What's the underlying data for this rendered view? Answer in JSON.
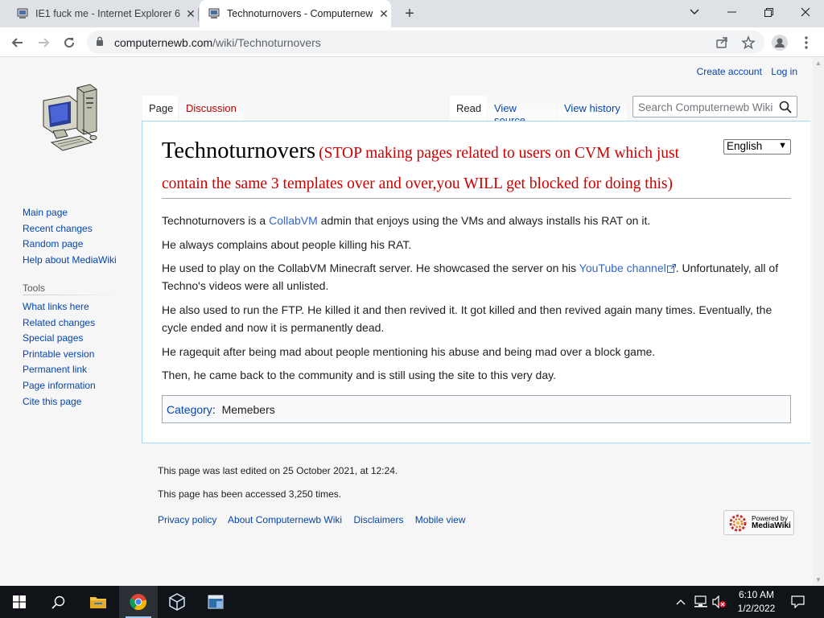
{
  "browser": {
    "tabs": [
      {
        "title": "IE1 fuck me - Internet Explorer 6",
        "active": false
      },
      {
        "title": "Technoturnovers - Computernewb",
        "active": true
      }
    ],
    "new_tab": "+",
    "window_controls": {
      "list": "⌄",
      "minimize": "—",
      "restore": "⧉",
      "close": "✕"
    },
    "url_host": "computernewb.com",
    "url_path": "/wiki/Technoturnovers"
  },
  "personal": {
    "create_account": "Create account",
    "log_in": "Log in"
  },
  "page_tabs": {
    "page": "Page",
    "discussion": "Discussion",
    "read": "Read",
    "view_source": "View source",
    "view_history": "View history"
  },
  "search": {
    "placeholder": "Search Computernewb Wiki"
  },
  "language": {
    "selected": "English"
  },
  "article": {
    "title": "Technoturnovers",
    "title_note": "(STOP making pages related to users on CVM which just contain the same 3 templates over and over,you WILL get blocked for doing this)",
    "p1_before": "Technoturnovers is a ",
    "p1_link": "CollabVM",
    "p1_after": " admin that enjoys using the VMs and always installs his RAT on it.",
    "p2": "He always complains about people killing his RAT.",
    "p3_before": "He used to play on the CollabVM Minecraft server. He showcased the server on his ",
    "p3_link": "YouTube channel",
    "p3_after": ". Unfortunately, all of Techno's videos were all unlisted.",
    "p4": "He also used to run the FTP. He killed it and then revived it. It got killed and then revived again many times. Eventually, the cycle ended and now it is permanently dead.",
    "p5": "He ragequit after being mad about people mentioning his abuse and being mad over a block game.",
    "p6": "Then, he came back to the community and is still using the site to this very day.",
    "category_label": "Category",
    "category_sep": ":",
    "category_value": "Memebers"
  },
  "sidebar": {
    "navigation": [
      "Main page",
      "Recent changes",
      "Random page",
      "Help about MediaWiki"
    ],
    "tools_heading": "Tools",
    "tools": [
      "What links here",
      "Related changes",
      "Special pages",
      "Printable version",
      "Permanent link",
      "Page information",
      "Cite this page"
    ]
  },
  "footer": {
    "last_edited": "This page was last edited on 25 October 2021, at 12:24.",
    "accessed": "This page has been accessed 3,250 times.",
    "links": [
      "Privacy policy",
      "About Computernewb Wiki",
      "Disclaimers",
      "Mobile view"
    ],
    "powered_top": "Powered by",
    "powered_bottom": "MediaWiki"
  },
  "taskbar": {
    "time": "6:10 AM",
    "date": "1/2/2022"
  }
}
